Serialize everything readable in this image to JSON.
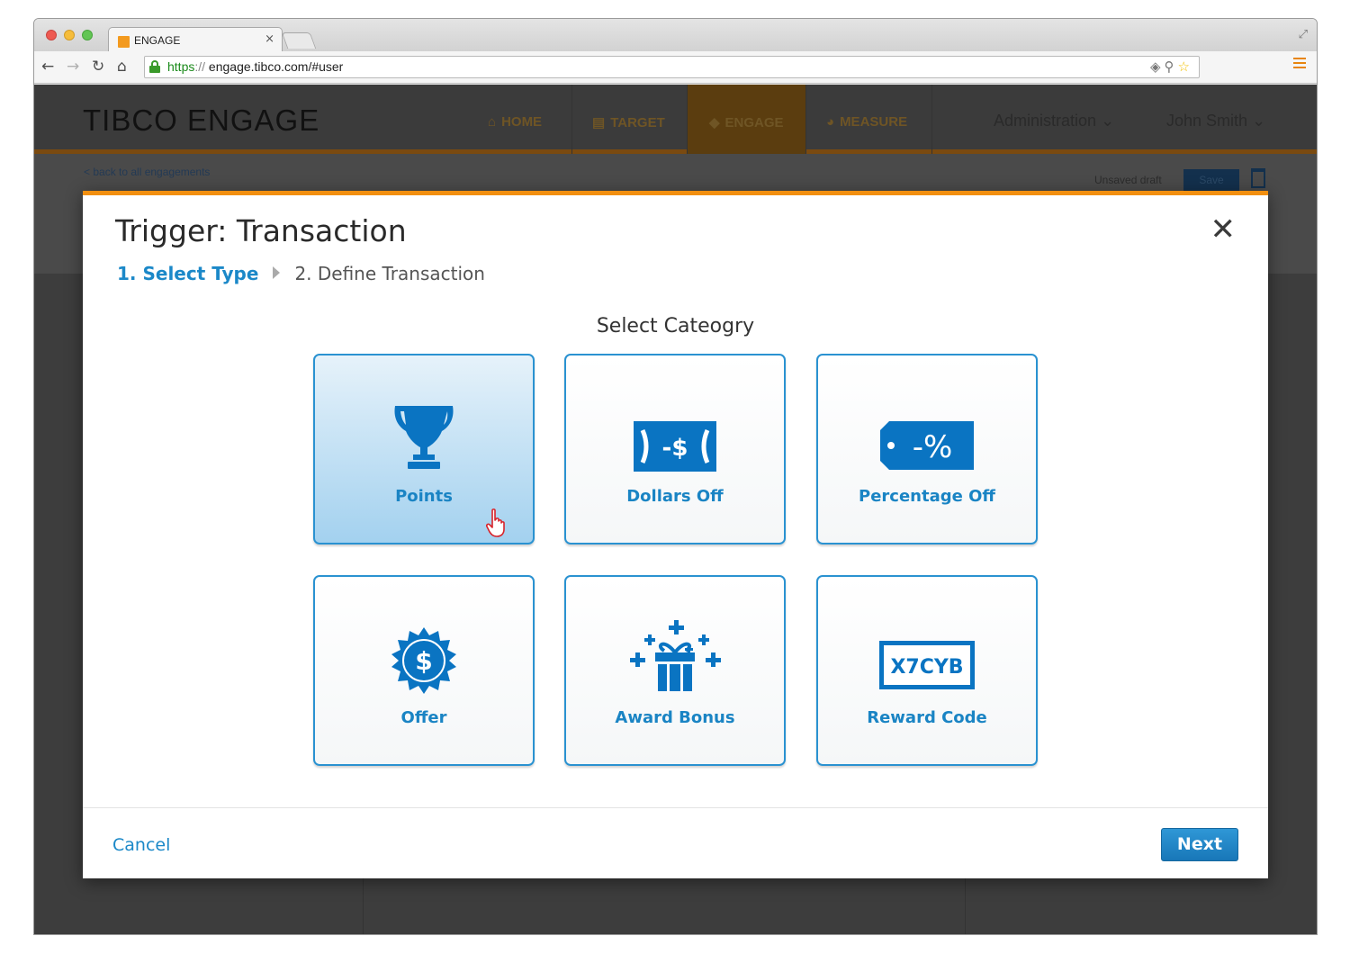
{
  "browser": {
    "tab_title": "ENGAGE",
    "tab_close": "×",
    "url_protocol": "https",
    "url_separator": "://",
    "url_rest": " engage.tibco.com/#user"
  },
  "app": {
    "logo": "TIBCO ENGAGE",
    "nav": {
      "home": "HOME",
      "target": "TARGET",
      "engage": "ENGAGE",
      "measure": "MEASURE",
      "admin": "Administration",
      "user": "John Smith"
    },
    "back_link": "< back to all engagements",
    "status": "Unsaved draft",
    "save_label": "Save"
  },
  "modal": {
    "title": "Trigger: Transaction",
    "close_glyph": "✕",
    "steps": {
      "step1": "1. Select Type",
      "step2": "2. Define Transaction"
    },
    "section_title": "Select Cateogry",
    "categories": [
      {
        "label": "Points",
        "icon": "trophy-icon",
        "selected": true
      },
      {
        "label": "Dollars Off",
        "icon": "dollar-bill-icon",
        "selected": false
      },
      {
        "label": "Percentage Off",
        "icon": "percent-tag-icon",
        "selected": false
      },
      {
        "label": "Offer",
        "icon": "dollar-badge-icon",
        "selected": false
      },
      {
        "label": "Award Bonus",
        "icon": "gift-icon",
        "selected": false
      },
      {
        "label": "Reward Code",
        "icon": "reward-code-icon",
        "selected": false
      }
    ],
    "percent_icon_text": "-%",
    "dollar_icon_text": "-$",
    "offer_icon_text": "$",
    "reward_code_text": "X7CYB",
    "cancel_label": "Cancel",
    "next_label": "Next"
  },
  "colors": {
    "accent": "#1b88c8",
    "modal_border": "#f28f0f",
    "card_border": "#2a92d1",
    "icon_blue": "#0a74c2"
  }
}
